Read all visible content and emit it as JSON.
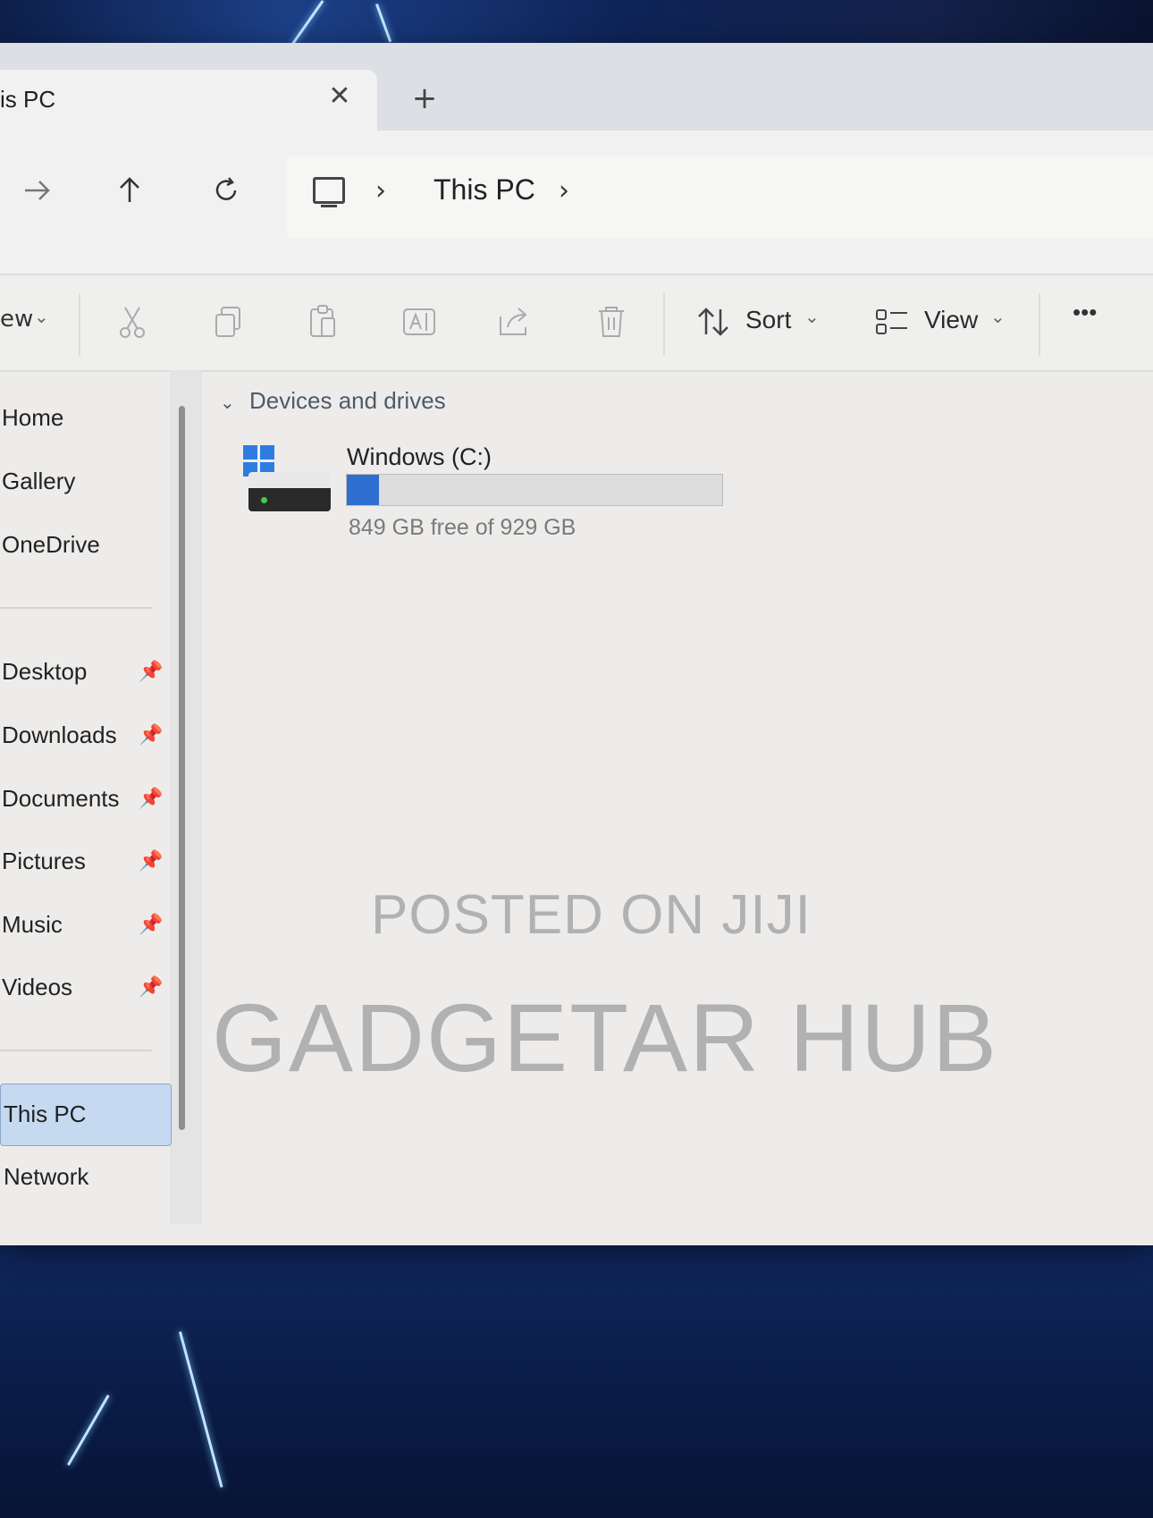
{
  "tab": {
    "title": "is PC",
    "close_glyph": "✕",
    "new_tab_glyph": "+"
  },
  "nav": {
    "forward_icon": "arrow-right-icon",
    "up_icon": "arrow-up-icon",
    "refresh_icon": "refresh-icon",
    "breadcrumb": [
      "This PC"
    ]
  },
  "toolbar": {
    "new_partial": "ew",
    "sort_label": "Sort",
    "view_label": "View",
    "more_glyph": "•••"
  },
  "sidebar": {
    "items_top": [
      "Home",
      "Gallery",
      "OneDrive"
    ],
    "pinned": [
      "Desktop",
      "Downloads",
      "Documents",
      "Pictures",
      "Music",
      "Videos"
    ],
    "items_bottom": [
      "This PC",
      "Network"
    ],
    "selected": "This PC"
  },
  "content": {
    "section_title": "Devices and drives",
    "drives": [
      {
        "name": "Windows (C:)",
        "free_text": "849 GB free of 929 GB",
        "used_fraction": 0.086
      }
    ]
  },
  "watermark": {
    "line1": "POSTED ON JIJI",
    "line2": "GADGETAR HUB"
  },
  "colors": {
    "selection": "#c5daf1",
    "drive_fill": "#2f6ed1",
    "windows_blue": "#2f7ce0"
  }
}
